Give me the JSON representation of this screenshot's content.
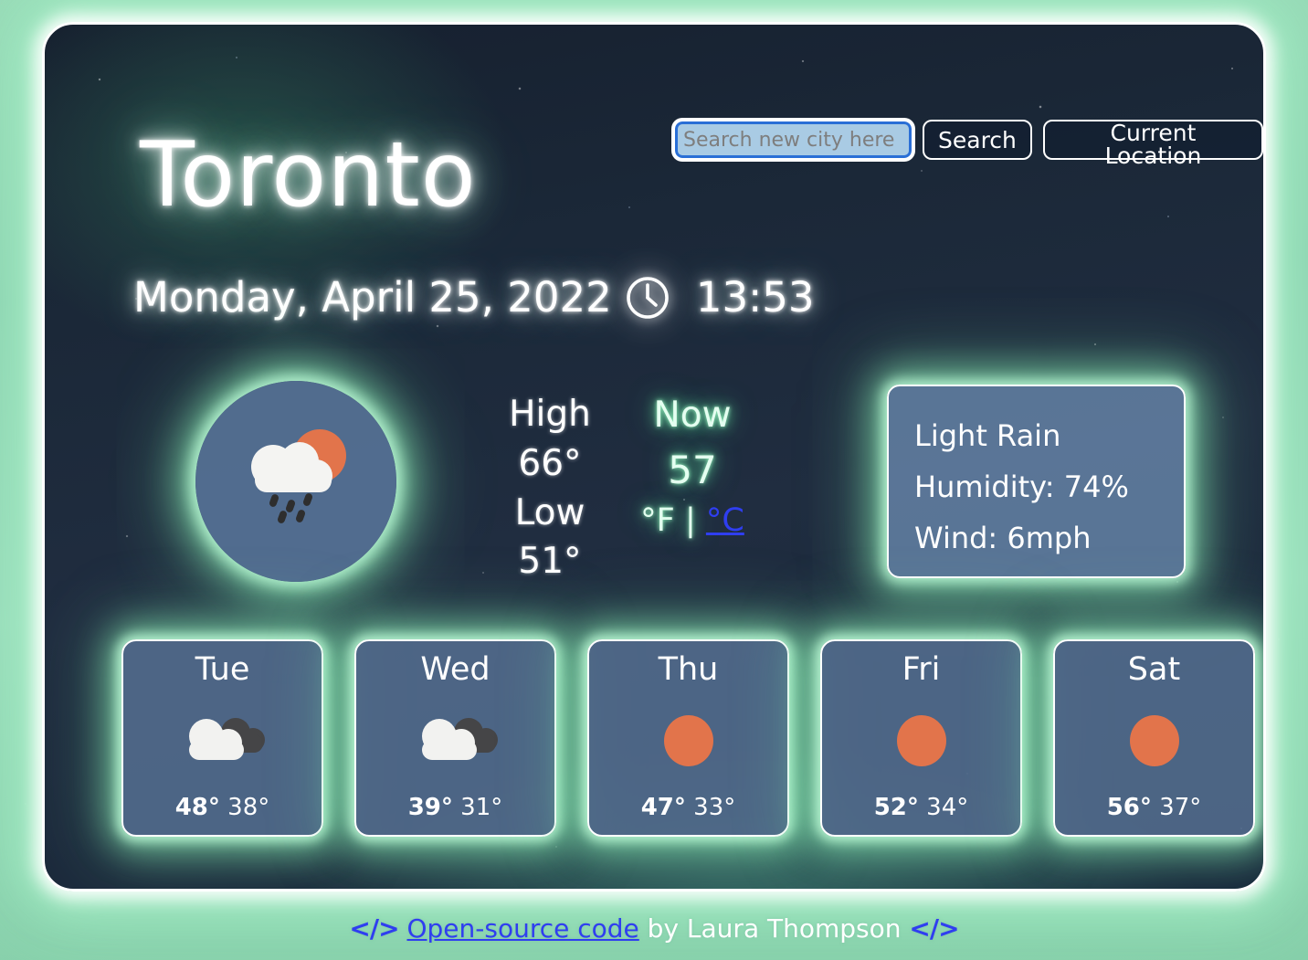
{
  "search": {
    "placeholder": "Search new city here",
    "value": "",
    "search_button": "Search",
    "location_button": "Current Location"
  },
  "header": {
    "city": "Toronto",
    "date": "Monday, April 25, 2022",
    "time": "13:53",
    "clock_icon": "clock-icon"
  },
  "current": {
    "main_icon": "sun-behind-rain-cloud-icon",
    "high_label": "High",
    "high_value": "66°",
    "low_label": "Low",
    "low_value": "51°",
    "now_label": "Now",
    "now_temp": "57",
    "unit_f": "°F",
    "unit_separator": "|",
    "unit_c": "°C",
    "description": "Light Rain",
    "humidity": "Humidity: 74%",
    "wind": "Wind: 6mph"
  },
  "forecast": [
    {
      "day": "Tue",
      "icon": "cloudy-icon",
      "high": "48°",
      "low": "38°"
    },
    {
      "day": "Wed",
      "icon": "cloudy-icon",
      "high": "39°",
      "low": "31°"
    },
    {
      "day": "Thu",
      "icon": "sun-icon",
      "high": "47°",
      "low": "33°"
    },
    {
      "day": "Fri",
      "icon": "sun-icon",
      "high": "52°",
      "low": "34°"
    },
    {
      "day": "Sat",
      "icon": "sun-icon",
      "high": "56°",
      "low": "37°"
    }
  ],
  "footer": {
    "bracket_left": "</>",
    "link_text": "Open-source code",
    "by_text": " by Laura Thompson ",
    "bracket_right": "</>"
  },
  "colors": {
    "page_green": "#8ed3b2",
    "glow_green": "#a8f0c8",
    "card_night": "#1b2838",
    "panel_blue": "#627fa3",
    "link_blue": "#2f3ef0",
    "sun_orange": "#e2744b",
    "cloud_white": "#f2f2f0",
    "cloud_dark": "#454547",
    "input_fill": "#a9cbe4"
  }
}
